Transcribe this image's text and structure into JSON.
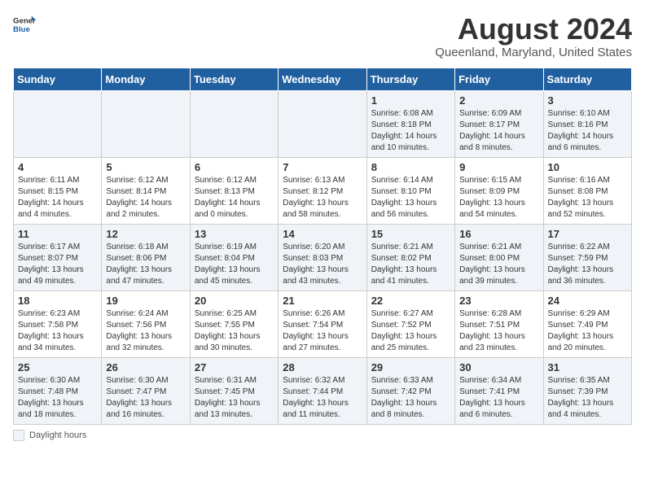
{
  "header": {
    "logo_general": "General",
    "logo_blue": "Blue",
    "month_year": "August 2024",
    "location": "Queenland, Maryland, United States"
  },
  "days_of_week": [
    "Sunday",
    "Monday",
    "Tuesday",
    "Wednesday",
    "Thursday",
    "Friday",
    "Saturday"
  ],
  "weeks": [
    [
      {
        "day": "",
        "info": ""
      },
      {
        "day": "",
        "info": ""
      },
      {
        "day": "",
        "info": ""
      },
      {
        "day": "",
        "info": ""
      },
      {
        "day": "1",
        "info": "Sunrise: 6:08 AM\nSunset: 8:18 PM\nDaylight: 14 hours\nand 10 minutes."
      },
      {
        "day": "2",
        "info": "Sunrise: 6:09 AM\nSunset: 8:17 PM\nDaylight: 14 hours\nand 8 minutes."
      },
      {
        "day": "3",
        "info": "Sunrise: 6:10 AM\nSunset: 8:16 PM\nDaylight: 14 hours\nand 6 minutes."
      }
    ],
    [
      {
        "day": "4",
        "info": "Sunrise: 6:11 AM\nSunset: 8:15 PM\nDaylight: 14 hours\nand 4 minutes."
      },
      {
        "day": "5",
        "info": "Sunrise: 6:12 AM\nSunset: 8:14 PM\nDaylight: 14 hours\nand 2 minutes."
      },
      {
        "day": "6",
        "info": "Sunrise: 6:12 AM\nSunset: 8:13 PM\nDaylight: 14 hours\nand 0 minutes."
      },
      {
        "day": "7",
        "info": "Sunrise: 6:13 AM\nSunset: 8:12 PM\nDaylight: 13 hours\nand 58 minutes."
      },
      {
        "day": "8",
        "info": "Sunrise: 6:14 AM\nSunset: 8:10 PM\nDaylight: 13 hours\nand 56 minutes."
      },
      {
        "day": "9",
        "info": "Sunrise: 6:15 AM\nSunset: 8:09 PM\nDaylight: 13 hours\nand 54 minutes."
      },
      {
        "day": "10",
        "info": "Sunrise: 6:16 AM\nSunset: 8:08 PM\nDaylight: 13 hours\nand 52 minutes."
      }
    ],
    [
      {
        "day": "11",
        "info": "Sunrise: 6:17 AM\nSunset: 8:07 PM\nDaylight: 13 hours\nand 49 minutes."
      },
      {
        "day": "12",
        "info": "Sunrise: 6:18 AM\nSunset: 8:06 PM\nDaylight: 13 hours\nand 47 minutes."
      },
      {
        "day": "13",
        "info": "Sunrise: 6:19 AM\nSunset: 8:04 PM\nDaylight: 13 hours\nand 45 minutes."
      },
      {
        "day": "14",
        "info": "Sunrise: 6:20 AM\nSunset: 8:03 PM\nDaylight: 13 hours\nand 43 minutes."
      },
      {
        "day": "15",
        "info": "Sunrise: 6:21 AM\nSunset: 8:02 PM\nDaylight: 13 hours\nand 41 minutes."
      },
      {
        "day": "16",
        "info": "Sunrise: 6:21 AM\nSunset: 8:00 PM\nDaylight: 13 hours\nand 39 minutes."
      },
      {
        "day": "17",
        "info": "Sunrise: 6:22 AM\nSunset: 7:59 PM\nDaylight: 13 hours\nand 36 minutes."
      }
    ],
    [
      {
        "day": "18",
        "info": "Sunrise: 6:23 AM\nSunset: 7:58 PM\nDaylight: 13 hours\nand 34 minutes."
      },
      {
        "day": "19",
        "info": "Sunrise: 6:24 AM\nSunset: 7:56 PM\nDaylight: 13 hours\nand 32 minutes."
      },
      {
        "day": "20",
        "info": "Sunrise: 6:25 AM\nSunset: 7:55 PM\nDaylight: 13 hours\nand 30 minutes."
      },
      {
        "day": "21",
        "info": "Sunrise: 6:26 AM\nSunset: 7:54 PM\nDaylight: 13 hours\nand 27 minutes."
      },
      {
        "day": "22",
        "info": "Sunrise: 6:27 AM\nSunset: 7:52 PM\nDaylight: 13 hours\nand 25 minutes."
      },
      {
        "day": "23",
        "info": "Sunrise: 6:28 AM\nSunset: 7:51 PM\nDaylight: 13 hours\nand 23 minutes."
      },
      {
        "day": "24",
        "info": "Sunrise: 6:29 AM\nSunset: 7:49 PM\nDaylight: 13 hours\nand 20 minutes."
      }
    ],
    [
      {
        "day": "25",
        "info": "Sunrise: 6:30 AM\nSunset: 7:48 PM\nDaylight: 13 hours\nand 18 minutes."
      },
      {
        "day": "26",
        "info": "Sunrise: 6:30 AM\nSunset: 7:47 PM\nDaylight: 13 hours\nand 16 minutes."
      },
      {
        "day": "27",
        "info": "Sunrise: 6:31 AM\nSunset: 7:45 PM\nDaylight: 13 hours\nand 13 minutes."
      },
      {
        "day": "28",
        "info": "Sunrise: 6:32 AM\nSunset: 7:44 PM\nDaylight: 13 hours\nand 11 minutes."
      },
      {
        "day": "29",
        "info": "Sunrise: 6:33 AM\nSunset: 7:42 PM\nDaylight: 13 hours\nand 8 minutes."
      },
      {
        "day": "30",
        "info": "Sunrise: 6:34 AM\nSunset: 7:41 PM\nDaylight: 13 hours\nand 6 minutes."
      },
      {
        "day": "31",
        "info": "Sunrise: 6:35 AM\nSunset: 7:39 PM\nDaylight: 13 hours\nand 4 minutes."
      }
    ]
  ],
  "footer": {
    "legend_label": "Daylight hours"
  }
}
